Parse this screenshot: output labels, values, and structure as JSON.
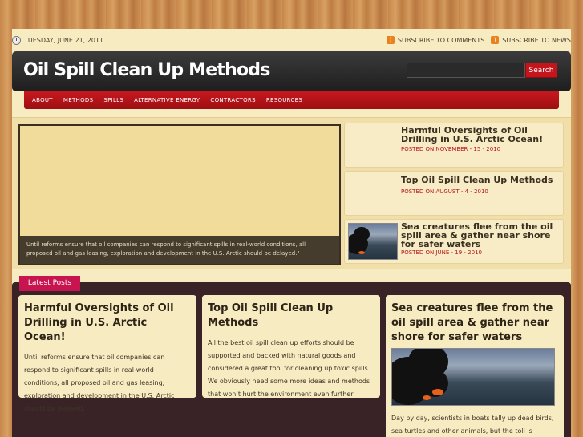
{
  "topbar": {
    "date": "TUESDAY, JUNE 21, 2011",
    "subscribe_comments": "SUBSCRIBE TO COMMENTS",
    "subscribe_news": "SUBSCRIBE TO NEWS"
  },
  "header": {
    "logo": "Oil Spill Clean Up Methods",
    "search_placeholder": "",
    "search_button": "Search"
  },
  "nav": [
    "ABOUT",
    "METHODS",
    "SPILLS",
    "ALTERNATIVE ENERGY",
    "CONTRACTORS",
    "RESOURCES"
  ],
  "featured": {
    "caption": "Until reforms ensure that oil companies can respond to significant spills in real-world conditions, all proposed oil and gas leasing, exploration and development in the U.S. Arctic should be delayed.\""
  },
  "side_posts": [
    {
      "title": "Harmful Oversights of Oil Drilling in U.S. Arctic Ocean!",
      "meta": "POSTED ON NOVEMBER - 15 - 2010"
    },
    {
      "title": "Top Oil Spill Clean Up Methods",
      "meta": "POSTED ON AUGUST - 4 - 2010"
    },
    {
      "title": "Sea creatures flee from the oil spill area & gather near shore for safer waters",
      "meta": "POSTED ON JUNE - 19 - 2010"
    }
  ],
  "latest": {
    "tab_label": "Latest Posts",
    "cards": [
      {
        "title": "Harmful Oversights of Oil Drilling in U.S. Arctic Ocean!",
        "excerpt": "Until reforms ensure that oil companies can respond to significant spills in real-world conditions, all proposed oil and gas leasing, exploration and development in the U.S. Arctic should be delayed.\""
      },
      {
        "title": "Top Oil Spill Clean Up Methods",
        "excerpt": "All the best oil spill clean up efforts should be supported and backed with natural goods and considered a great tool for cleaning up toxic spills. We obviously need some more ideas and methods that won’t hurt the environment even further"
      },
      {
        "title": "Sea creatures flee from the oil spill area & gather near shore for safer waters",
        "excerpt": "Day by day, scientists in boats tally up dead birds, sea turtles and other animals, but the toll is"
      }
    ]
  },
  "colors": {
    "accent": "#c4141c",
    "tab": "#c8154f",
    "panel": "#f7ebc2",
    "dark": "#3a2327"
  }
}
